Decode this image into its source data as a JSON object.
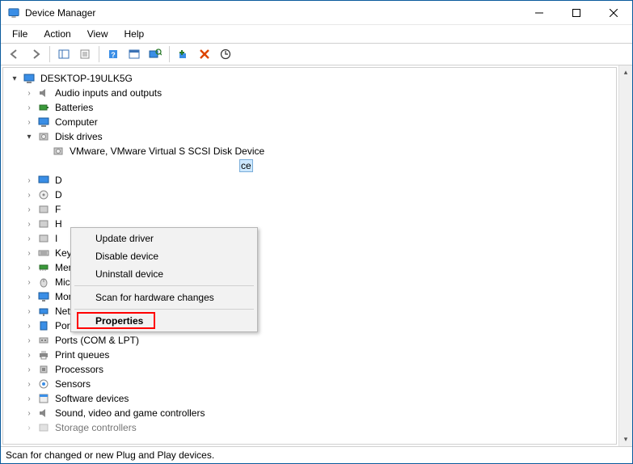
{
  "title": "Device Manager",
  "menubar": [
    "File",
    "Action",
    "View",
    "Help"
  ],
  "tree": {
    "root": "DESKTOP-19ULK5G",
    "items": [
      {
        "label": "Audio inputs and outputs",
        "expanded": false
      },
      {
        "label": "Batteries",
        "expanded": false
      },
      {
        "label": "Computer",
        "expanded": false
      },
      {
        "label": "Disk drives",
        "expanded": true,
        "children": [
          {
            "label": "VMware, VMware Virtual S SCSI Disk Device"
          },
          {
            "label": "ce",
            "selected": true
          }
        ]
      },
      {
        "label": "D",
        "expanded": false
      },
      {
        "label": "D",
        "expanded": false
      },
      {
        "label": "F",
        "expanded": false
      },
      {
        "label": "H",
        "expanded": false
      },
      {
        "label": "I",
        "expanded": false
      },
      {
        "label": "Keyboards",
        "expanded": false
      },
      {
        "label": "Memory devices",
        "expanded": false
      },
      {
        "label": "Mice and other pointing devices",
        "expanded": false
      },
      {
        "label": "Monitors",
        "expanded": false
      },
      {
        "label": "Network adapters",
        "expanded": false
      },
      {
        "label": "Portable Devices",
        "expanded": false
      },
      {
        "label": "Ports (COM & LPT)",
        "expanded": false
      },
      {
        "label": "Print queues",
        "expanded": false
      },
      {
        "label": "Processors",
        "expanded": false
      },
      {
        "label": "Sensors",
        "expanded": false
      },
      {
        "label": "Software devices",
        "expanded": false
      },
      {
        "label": "Sound, video and game controllers",
        "expanded": false
      },
      {
        "label": "Storage controllers",
        "expanded": false,
        "truncated": true
      }
    ]
  },
  "context_menu": [
    "Update driver",
    "Disable device",
    "Uninstall device",
    "---",
    "Scan for hardware changes",
    "---",
    "Properties"
  ],
  "statusbar": "Scan for changed or new Plug and Play devices.",
  "colors": {
    "accent": "#0a5a9c",
    "selection": "#cde8ff"
  }
}
